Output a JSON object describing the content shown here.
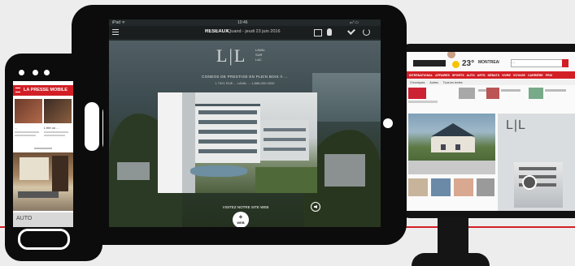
{
  "colors": {
    "accent": "#d21f26",
    "logo": "#d8d8d8"
  },
  "tablet": {
    "status": {
      "left": "iPad ᯤ",
      "time": "10:46",
      "right": "⁎ ⁄ ▭"
    },
    "toolbar": {
      "menu_icon": "hamburger-icon",
      "brand": "RÉSEAUX",
      "date": "Quand - jeudi 23 juin 2016"
    },
    "ad": {
      "logo_letters": "L|L",
      "logo_line1": "LAVAL",
      "logo_line2": "SUR",
      "logo_line3": "LAC",
      "tagline": "CONDOS DE PRESTIGE EN PLEIN BOIS À ...",
      "address": "1 7321 RUE ... LAVAL ... 1-888-000-0000",
      "visit": "VISITEZ NOTRE SITE WEB",
      "badge": "WEB"
    }
  },
  "phone": {
    "header": "LA PRESSE MOBILE",
    "headline1": "...",
    "headline2": "L'été où ...",
    "section_label": "AUTO"
  },
  "monitor": {
    "weather": "23°",
    "city": "MONTRÉAL",
    "search_placeholder": "...",
    "nav": [
      "INTERNATIONAL",
      "AFFAIRES",
      "SPORTS",
      "AUTO",
      "ARTS",
      "DÉBATS",
      "VIVRE",
      "VOYAGE",
      "CARRIÈRE",
      "PRIX"
    ],
    "subnav": [
      "Chroniques",
      "Autres",
      "Tous les textes"
    ],
    "ad_letters": "L|L"
  }
}
